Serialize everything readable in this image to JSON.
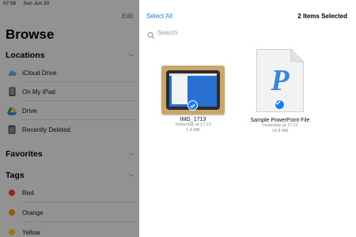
{
  "status_bar": {
    "time": "07:56",
    "date": "Sun Jun 30"
  },
  "sidebar": {
    "edit_label": "Edit",
    "title": "Browse",
    "sections": {
      "locations": {
        "title": "Locations",
        "items": [
          {
            "label": "iCloud Drive",
            "icon": "icloud-icon"
          },
          {
            "label": "On My iPad",
            "icon": "ipad-icon"
          },
          {
            "label": "Drive",
            "icon": "google-drive-icon"
          },
          {
            "label": "Recently Deleted",
            "icon": "trash-icon"
          }
        ]
      },
      "favorites": {
        "title": "Favorites"
      },
      "tags": {
        "title": "Tags",
        "items": [
          {
            "label": "Red",
            "color": "#ff3b30"
          },
          {
            "label": "Orange",
            "color": "#ff9500"
          },
          {
            "label": "Yellow",
            "color": "#ffcc00"
          }
        ]
      }
    }
  },
  "main": {
    "select_all_label": "Select All",
    "selection_count": "2 Items Selected",
    "search_placeholder": "Search",
    "files": [
      {
        "name": "IMG_1713",
        "date": "Yesterday at 17:12",
        "size": "1.4 MB",
        "selected": true
      },
      {
        "name": "Sample PowerPoint File",
        "date": "Yesterday at 17:12",
        "size": "14.8 MB",
        "selected": true
      }
    ]
  },
  "colors": {
    "accent": "#1a7cf5",
    "dim_overlay": "rgba(0,0,0,0.40)"
  }
}
